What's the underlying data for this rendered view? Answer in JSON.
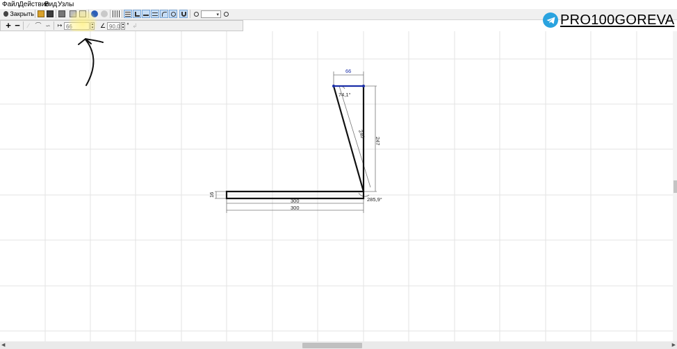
{
  "menu": {
    "file": "Файл",
    "action": "Действие",
    "view": "Вид",
    "nodes": "Узлы"
  },
  "toolbar": {
    "close_label": "Закрыть",
    "zoom_value": ""
  },
  "toolbar2": {
    "length_value": "66",
    "angle_value": "90,0",
    "degree_unit": "°"
  },
  "brand": {
    "text": "PRO100GOREVA",
    "accent": "#2aa3df"
  },
  "drawing": {
    "top_dim": "66",
    "angle_top": "74,1°",
    "diag_dim": "240",
    "right_dim": "247",
    "left_dim": "16",
    "bottom_inner": "300",
    "bottom_outer": "300",
    "angle_bottom": "285,9°"
  }
}
